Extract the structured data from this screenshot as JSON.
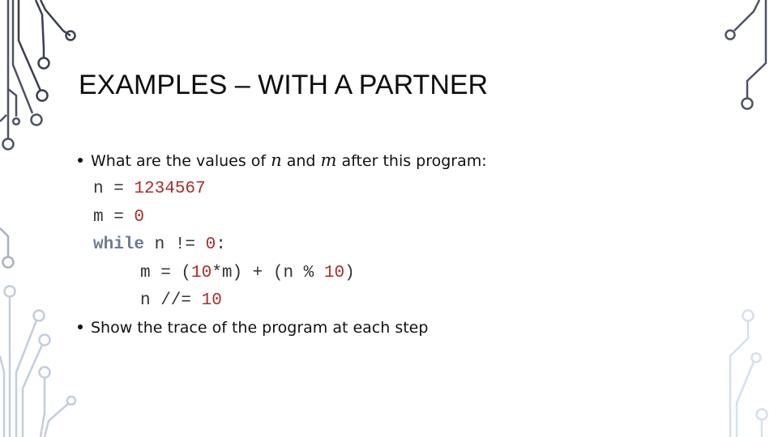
{
  "slide": {
    "title": "EXAMPLES – WITH A PARTNER",
    "bullets": [
      {
        "parts": [
          "What are the values of ",
          "n",
          " and ",
          "m",
          " after this program:"
        ]
      },
      {
        "text": "Show the trace of the program at each step"
      }
    ],
    "code": {
      "line1": {
        "var": "n",
        "op": " = ",
        "value": "1234567"
      },
      "line2": {
        "var": "m",
        "op": " = ",
        "value": "0"
      },
      "line3": {
        "keyword": "while",
        "cond": " n != ",
        "value": "0",
        "colon": ":"
      },
      "line4": {
        "a": "m = (",
        "n1": "10",
        "b": "*m) + (n % ",
        "n2": "10",
        "c": ")"
      },
      "line5": {
        "a": "n //= ",
        "n1": "10"
      }
    },
    "colors": {
      "number": "#b02a2a",
      "keyword": "#6b7b95",
      "circuit_dark": "#3e4356",
      "circuit_light": "#d5dfee"
    }
  }
}
